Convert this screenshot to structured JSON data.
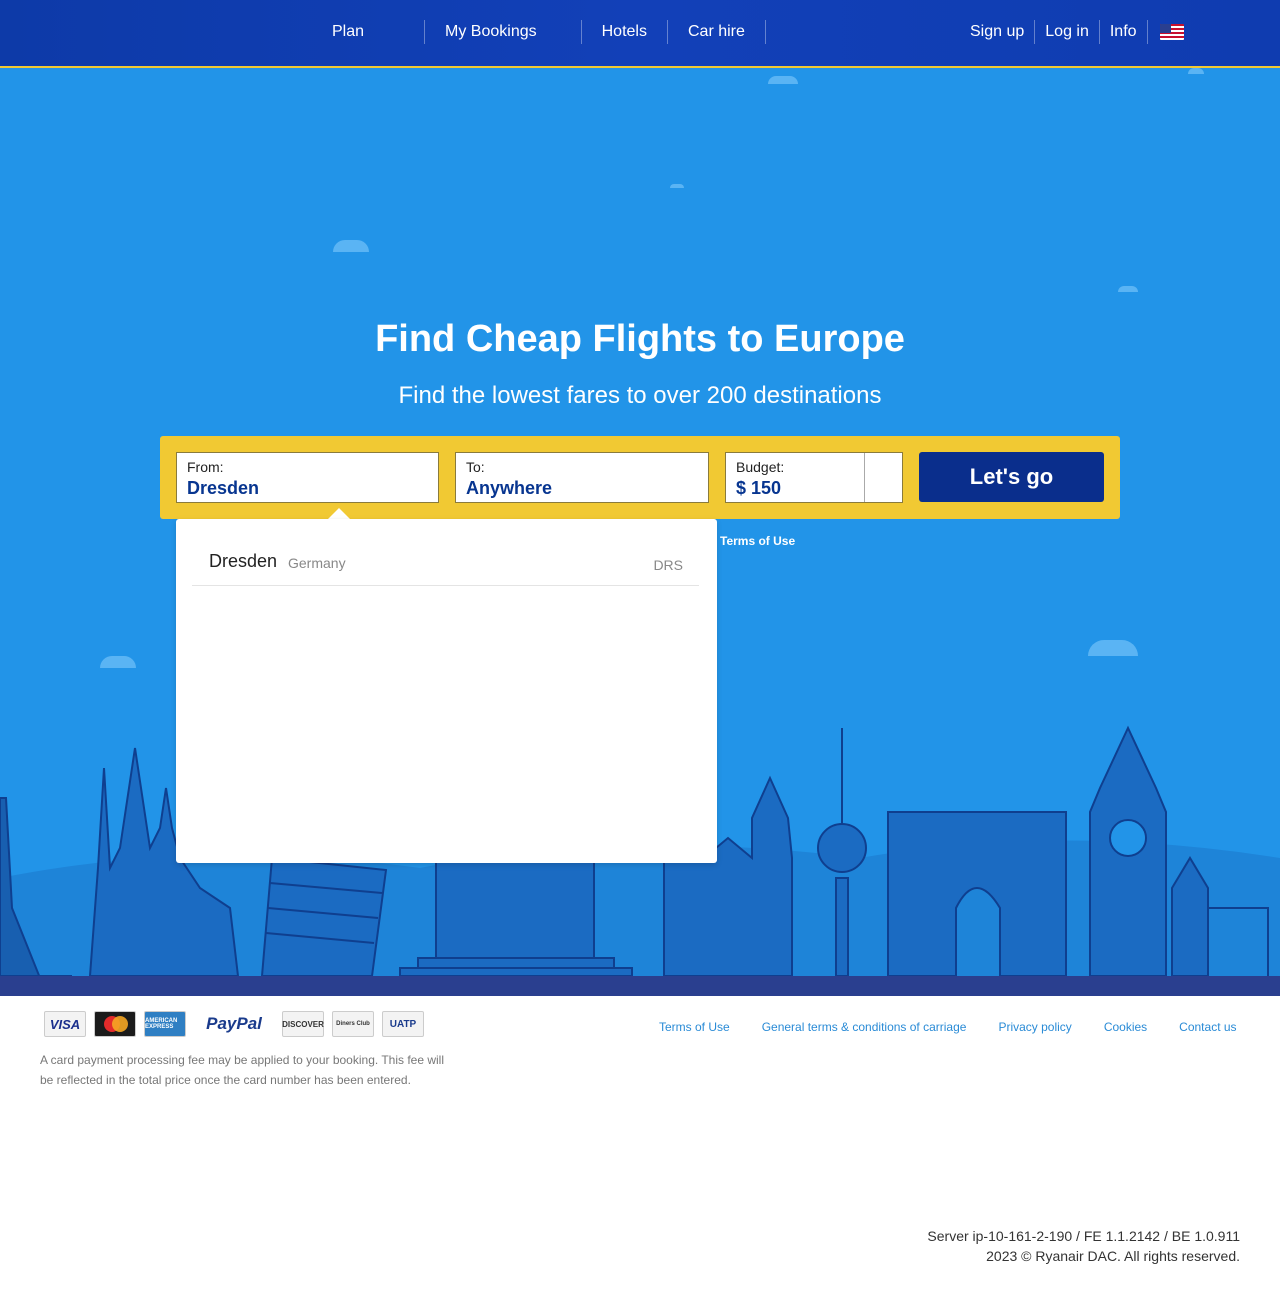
{
  "header": {
    "nav_left": [
      "Plan",
      "My Bookings",
      "Hotels",
      "Car hire"
    ],
    "nav_right": [
      "Sign up",
      "Log in",
      "Info"
    ],
    "flag_icon": "us-flag-icon"
  },
  "hero": {
    "title": "Find Cheap Flights to Europe",
    "subtitle": "Find the lowest fares to over 200 destinations"
  },
  "search": {
    "from_label": "From:",
    "from_value": "Dresden",
    "to_label": "To:",
    "to_value": "Anywhere",
    "budget_label": "Budget:",
    "budget_value": "$ 150",
    "submit_label": "Let's go"
  },
  "terms_link": "Terms of Use",
  "dropdown": {
    "items": [
      {
        "city": "Dresden",
        "country": "Germany",
        "code": "DRS"
      }
    ]
  },
  "footer": {
    "payments": {
      "visa": "VISA",
      "amex": "AMERICAN EXPRESS",
      "paypal": "PayPal",
      "discover": "DISCOVER",
      "diners": "Diners Club",
      "uatp": "UATP"
    },
    "fee_note": "A card payment processing fee may be applied to your booking. This fee will be reflected in the total price once the card number has been entered.",
    "links": [
      "Terms of Use",
      "General terms & conditions of carriage",
      "Privacy policy",
      "Cookies",
      "Contact us"
    ],
    "server": "Server ip-10-161-2-190 / FE 1.1.2142 / BE 1.0.911",
    "copyright": "2023 © Ryanair DAC. All rights reserved."
  },
  "colors": {
    "header_blue": "#1240b8",
    "hero_blue": "#2294e8",
    "accent_yellow": "#f1c933",
    "button_navy": "#0a2e8c"
  }
}
